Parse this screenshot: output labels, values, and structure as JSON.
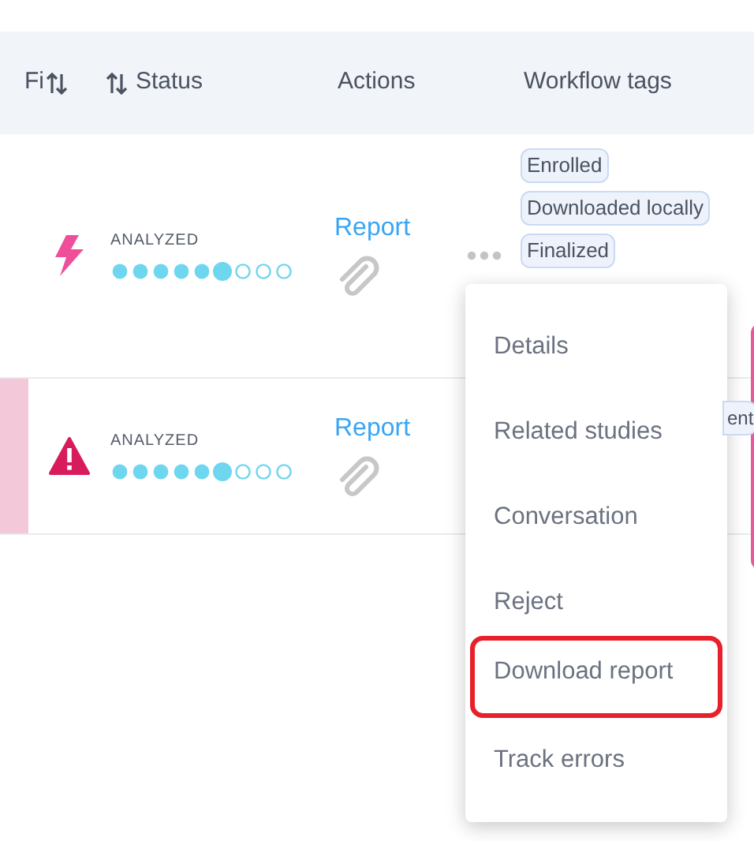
{
  "table": {
    "columns": [
      {
        "label": "Fi"
      },
      {
        "sortable": true
      },
      {
        "label": "Status",
        "sortable": true
      },
      {
        "label": "Actions",
        "sortable": false
      },
      {
        "label": "Workflow tags",
        "sortable": false
      }
    ],
    "rows": [
      {
        "kind": "bolt",
        "flagged": false,
        "status": "ANALYZED",
        "level": 0.6667,
        "action": "Report",
        "tags": [
          "Enrolled",
          "Downloaded locally",
          "Finalized"
        ]
      },
      {
        "kind": "warning",
        "flagged": true,
        "status": "ANALYZED",
        "level": 0.6667,
        "action": "Report",
        "tags": [
          "ent"
        ]
      }
    ]
  },
  "menu": {
    "items": [
      {
        "label": "Details",
        "highlighted": false
      },
      {
        "label": "Related studies",
        "highlighted": false
      },
      {
        "label": "Conversation",
        "highlighted": false
      },
      {
        "label": "Reject",
        "highlighted": false
      },
      {
        "label": "Download report",
        "highlighted": true
      },
      {
        "label": "Track errors",
        "highlighted": false
      }
    ]
  }
}
